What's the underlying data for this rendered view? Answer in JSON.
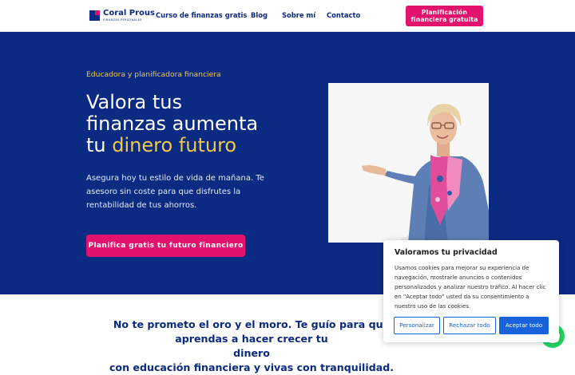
{
  "header": {
    "logo_name": "Coral Prous",
    "logo_sub": "FINANZAS PERSONALES",
    "nav": [
      {
        "label": "Curso de finanzas gratis"
      },
      {
        "label": "Blog"
      },
      {
        "label": "Sobre mí"
      },
      {
        "label": "Contacto"
      }
    ],
    "cta_line1": "Planificación",
    "cta_line2": "financiera gratuita"
  },
  "hero": {
    "eyebrow": "Educadora y planificadora financiera",
    "title_line1": "Valora tus",
    "title_line2": "finanzas aumenta",
    "title_line3_prefix": "tu ",
    "title_line3_accent": "dinero futuro",
    "description": "Asegura hoy tu estilo de vida de mañana. Te asesoro sin coste para que disfrutes la rentabilidad de tus ahorros.",
    "cta": "Planifica gratis tu futuro financiero"
  },
  "section": {
    "tagline_line1": "No te prometo el oro y el moro. Te guío para que aprendas a hacer crecer tu",
    "tagline_line2": "dinero",
    "tagline_line3": "con educación financiera y vivas con tranquilidad."
  },
  "cookie_banner": {
    "title": "Valoramos tu privacidad",
    "text": "Usamos cookies para mejorar su experiencia de navegación, mostrarle anuncios o contenidos personalizados y analizar nuestro tráfico. Al hacer clic en \"Aceptar todo\" usted da su consentimiento a nuestro uso de las cookies.",
    "customize": "Personalizar",
    "reject": "Rechazar todo",
    "accept": "Aceptar todo"
  },
  "colors": {
    "brand_navy": "#0b2a82",
    "brand_pink": "#e2126e",
    "accent_yellow": "#f1c84b",
    "cookie_blue": "#1863dc",
    "whatsapp_green": "#25d366"
  },
  "icons": {
    "logo": "coral-prous-logo-icon",
    "chat": "whatsapp-icon"
  }
}
